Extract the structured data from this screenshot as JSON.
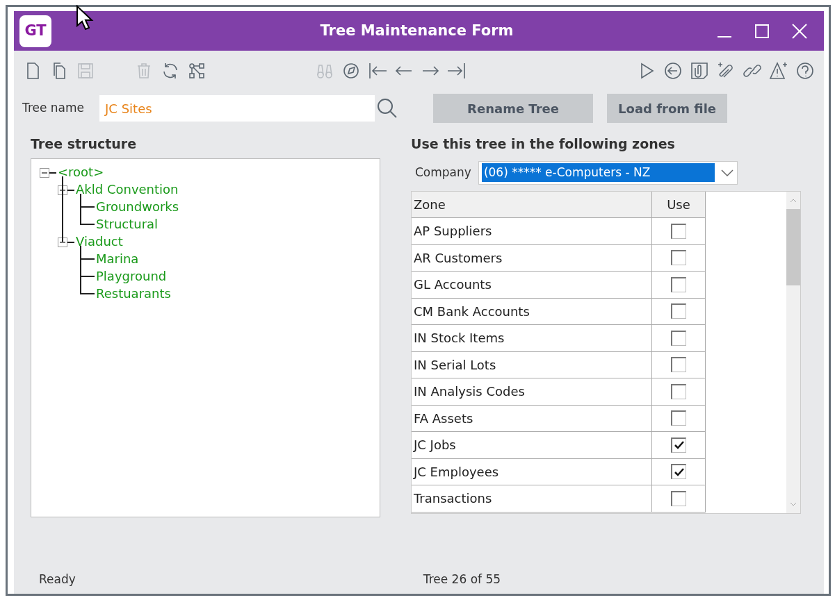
{
  "window": {
    "logo": "GT",
    "title": "Tree Maintenance Form"
  },
  "toolbar": [
    [
      {
        "kind": "new",
        "disabled": false
      },
      {
        "kind": "copy",
        "disabled": false
      },
      {
        "kind": "save",
        "disabled": true
      }
    ],
    [
      {
        "kind": "delete",
        "disabled": true
      },
      {
        "kind": "refresh",
        "disabled": false
      },
      {
        "kind": "hierarchy",
        "disabled": false
      }
    ],
    [
      {
        "kind": "find",
        "disabled": true
      },
      {
        "kind": "compass",
        "disabled": false
      },
      {
        "kind": "first",
        "disabled": false
      },
      {
        "kind": "previous",
        "disabled": false
      },
      {
        "kind": "next",
        "disabled": false
      },
      {
        "kind": "last",
        "disabled": false
      }
    ],
    [
      {
        "kind": "play",
        "disabled": false
      },
      {
        "kind": "back",
        "disabled": false
      },
      {
        "kind": "note",
        "disabled": false
      },
      {
        "kind": "attach",
        "disabled": false
      },
      {
        "kind": "link",
        "disabled": false
      },
      {
        "kind": "alert",
        "disabled": false
      },
      {
        "kind": "help",
        "disabled": false
      }
    ]
  ],
  "tree_name": {
    "label": "Tree name",
    "value": "JC Sites"
  },
  "buttons": [
    "Rename Tree",
    "Load from file"
  ],
  "tree_structure": {
    "title": "Tree structure",
    "nodes": [
      {
        "label": "<root>",
        "expanded": true,
        "children": [
          {
            "label": "Akld Convention",
            "expanded": true,
            "children": [
              {
                "label": "Groundworks"
              },
              {
                "label": "Structural"
              }
            ]
          },
          {
            "label": "Viaduct",
            "expanded": true,
            "children": [
              {
                "label": "Marina"
              },
              {
                "label": "Playground"
              },
              {
                "label": "Restuarants"
              }
            ]
          }
        ]
      }
    ]
  },
  "zones": {
    "title": "Use this tree in the following zones",
    "company_label": "Company",
    "company_value": "(06) ***** e-Computers - NZ",
    "company_focused": true,
    "columns": [
      "Zone",
      "Use"
    ],
    "rows": [
      {
        "zone": "AP Suppliers",
        "checked": false
      },
      {
        "zone": "AR Customers",
        "checked": false
      },
      {
        "zone": "GL Accounts",
        "checked": false
      },
      {
        "zone": "CM Bank Accounts",
        "checked": false
      },
      {
        "zone": "IN Stock Items",
        "checked": false
      },
      {
        "zone": "IN Serial Lots",
        "checked": false
      },
      {
        "zone": "IN Analysis Codes",
        "checked": false
      },
      {
        "zone": "FA Assets",
        "checked": false
      },
      {
        "zone": "JC Jobs",
        "checked": true
      },
      {
        "zone": "JC Employees",
        "checked": true
      },
      {
        "zone": "Transactions",
        "checked": false
      }
    ]
  },
  "status_bar": {
    "left": "Ready",
    "center": "Tree 26 of 55"
  }
}
